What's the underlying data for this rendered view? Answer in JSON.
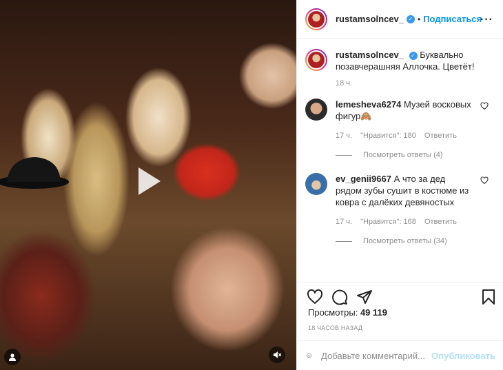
{
  "header": {
    "username": "rustamsolncev_",
    "separator": "•",
    "follow_label": "Подписаться",
    "more_icon": "ellipsis-icon"
  },
  "caption": {
    "username": "rustamsolncev_",
    "text": "Буквально позавчерашняя Аллочка. Цветёт!",
    "time": "18 ч."
  },
  "comments": [
    {
      "username": "lemesheva6274",
      "text": "Музей восковых фигур🙈",
      "time": "17 ч.",
      "likes": "\"Нравится\": 180",
      "reply_label": "Ответить",
      "view_replies": "Посмотреть ответы (4)"
    },
    {
      "username": "ev_genii9667",
      "text": "А что за дед рядом зубы сушит в костюме из ковра с далёких девяностых",
      "time": "17 ч.",
      "likes": "\"Нравится\": 168",
      "reply_label": "Ответить",
      "view_replies": "Посмотреть ответы (34)"
    }
  ],
  "stats": {
    "views_label": "Просмотры:",
    "views_value": "49 119",
    "posted_ago": "18 ЧАСОВ НАЗАД"
  },
  "comment_box": {
    "placeholder": "Добавьте комментарий...",
    "publish_label": "Опубликовать"
  },
  "colors": {
    "accent": "#0095f6",
    "verified": "#3897f0",
    "muted": "#8e8e8e",
    "publish_disabled": "#b2dffc"
  }
}
